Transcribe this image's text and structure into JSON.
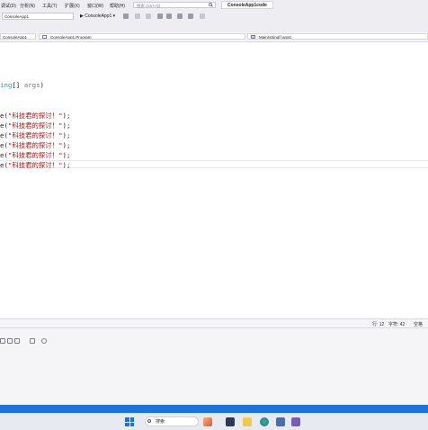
{
  "menu": {
    "items": [
      "调试(D)",
      "分析(N)",
      "工具(T)",
      "扩展(X)",
      "窗口(W)",
      "帮助(H)"
    ],
    "search_placeholder": "搜索 (Ctrl+Q)",
    "project_title": "ConsoleApp1code"
  },
  "toolbar": {
    "config_value": "ConsoleApp1",
    "run_label": "▶ ConsoleApp1 ▾"
  },
  "navbar": {
    "project": "ConsoleApp1",
    "class": "ConsoleApp1.Program",
    "member": "Main(string[] args)"
  },
  "code": {
    "signature_kw": "ing",
    "signature_rest": "[] ",
    "signature_param": "args",
    "signature_close": ")",
    "write_lines": [
      {
        "prefix": "e(",
        "text": "\"科技君的探讨！\"",
        "suffix": ");"
      },
      {
        "prefix": "e(",
        "text": "\"科技君的探讨！\"",
        "suffix": ");"
      },
      {
        "prefix": "e(",
        "text": "\"科技君的探讨！\"",
        "suffix": ");"
      },
      {
        "prefix": "e(",
        "text": "\"科技君的探讨！\"",
        "suffix": ");"
      },
      {
        "prefix": "e(",
        "text": "\"科技君的探讨！\"",
        "suffix": ");"
      },
      {
        "prefix": "e(",
        "text": "\"科技君的探讨！\"",
        "suffix": ");"
      }
    ]
  },
  "editor_status": {
    "line": "行: 12",
    "char": "字符: 42",
    "ins": "空格"
  },
  "taskbar": {
    "search_label": "搜索"
  },
  "colors": {
    "accent": "#1e74d6",
    "keyword": "#2b91af",
    "string": "#a31515"
  }
}
